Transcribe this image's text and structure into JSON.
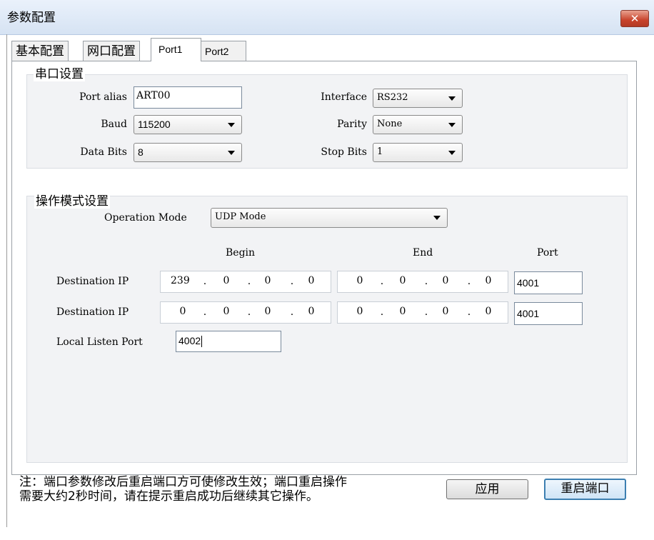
{
  "window": {
    "title": "参数配置",
    "close_glyph": "✕"
  },
  "tabs": [
    {
      "label": "基本配置",
      "active": false
    },
    {
      "label": "网口配置",
      "active": false
    },
    {
      "label": "Port1",
      "active": true
    },
    {
      "label": "Port2",
      "active": false
    }
  ],
  "serial": {
    "group_title": "串口设置",
    "port_alias": {
      "label": "Port alias",
      "value": "ART00"
    },
    "interface": {
      "label": "Interface",
      "value": "RS232"
    },
    "baud": {
      "label": "Baud",
      "value": "115200"
    },
    "parity": {
      "label": "Parity",
      "value": "None"
    },
    "data_bits": {
      "label": "Data Bits",
      "value": "8"
    },
    "stop_bits": {
      "label": "Stop Bits",
      "value": "1"
    }
  },
  "operation": {
    "group_title": "操作模式设置",
    "mode_label": "Operation Mode",
    "mode_value": "UDP Mode",
    "col_begin": "Begin",
    "col_end": "End",
    "col_port": "Port",
    "rows": [
      {
        "label": "Destination IP",
        "begin": [
          "239",
          "0",
          "0",
          "0"
        ],
        "end": [
          "0",
          "0",
          "0",
          "0"
        ],
        "port": "4001"
      },
      {
        "label": "Destination IP",
        "begin": [
          "0",
          "0",
          "0",
          "0"
        ],
        "end": [
          "0",
          "0",
          "0",
          "0"
        ],
        "port": "4001"
      }
    ],
    "local_port_label": "Local Listen Port",
    "local_port_value": "4002"
  },
  "footer": {
    "note_line1": "注：端口参数修改后重启端口方可使修改生效；端口重启操作",
    "note_line2": "需要大约2秒时间，请在提示重启成功后继续其它操作。",
    "apply_label": "应用",
    "restart_label": "重启端口"
  },
  "colors": {
    "accent": "#3c7fb1",
    "close": "#c8432b",
    "group_bg": "#f2f3f5"
  }
}
